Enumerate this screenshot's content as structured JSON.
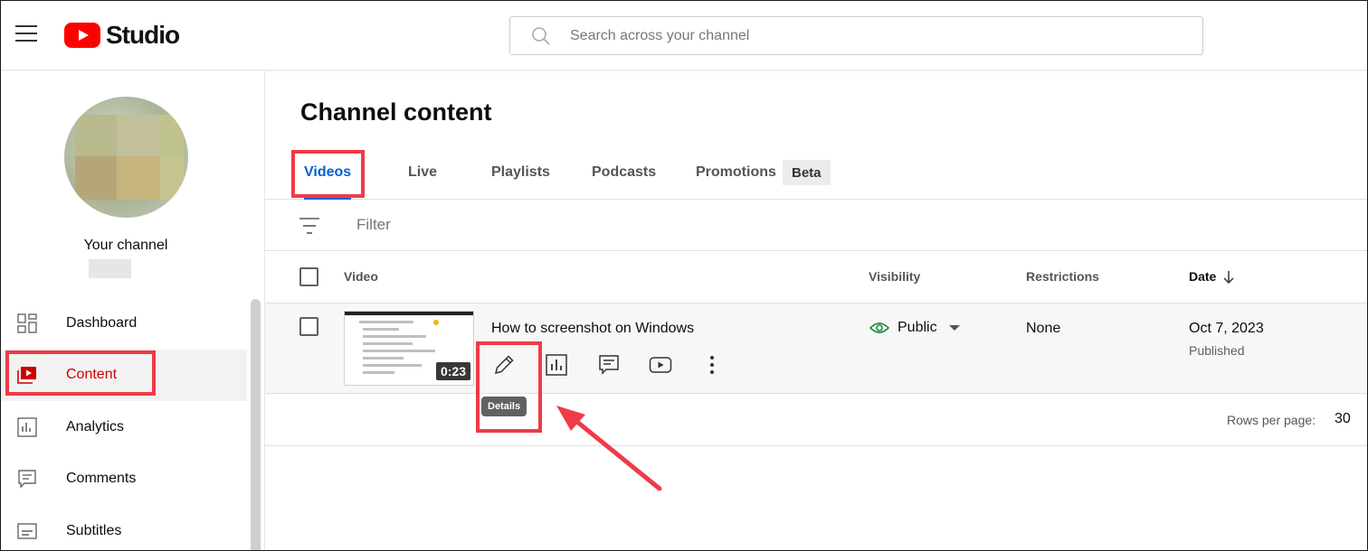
{
  "header": {
    "app_name": "Studio",
    "search_placeholder": "Search across your channel"
  },
  "sidebar": {
    "channel_label": "Your channel",
    "items": [
      {
        "label": "Dashboard",
        "icon": "dashboard-icon"
      },
      {
        "label": "Content",
        "icon": "content-icon",
        "active": true
      },
      {
        "label": "Analytics",
        "icon": "analytics-icon"
      },
      {
        "label": "Comments",
        "icon": "comments-icon"
      },
      {
        "label": "Subtitles",
        "icon": "subtitles-icon"
      }
    ]
  },
  "main": {
    "title": "Channel content",
    "tabs": [
      {
        "label": "Videos",
        "active": true
      },
      {
        "label": "Live"
      },
      {
        "label": "Playlists"
      },
      {
        "label": "Podcasts"
      },
      {
        "label": "Promotions"
      }
    ],
    "beta_badge": "Beta",
    "filter_label": "Filter",
    "columns": {
      "video": "Video",
      "visibility": "Visibility",
      "restrictions": "Restrictions",
      "date": "Date"
    },
    "rows": [
      {
        "title": "How to screenshot on Windows",
        "duration": "0:23",
        "visibility": "Public",
        "restrictions": "None",
        "date": "Oct 7, 2023",
        "date_status": "Published"
      }
    ],
    "tooltip": "Details",
    "rows_per_page_label": "Rows per page:",
    "rows_per_page_value": "30"
  },
  "colors": {
    "brand_red": "#ff0000",
    "active_tab": "#065fd4",
    "active_nav": "#cc0000",
    "visibility_green": "#1e8e3e",
    "highlight": "#ef3b47"
  }
}
